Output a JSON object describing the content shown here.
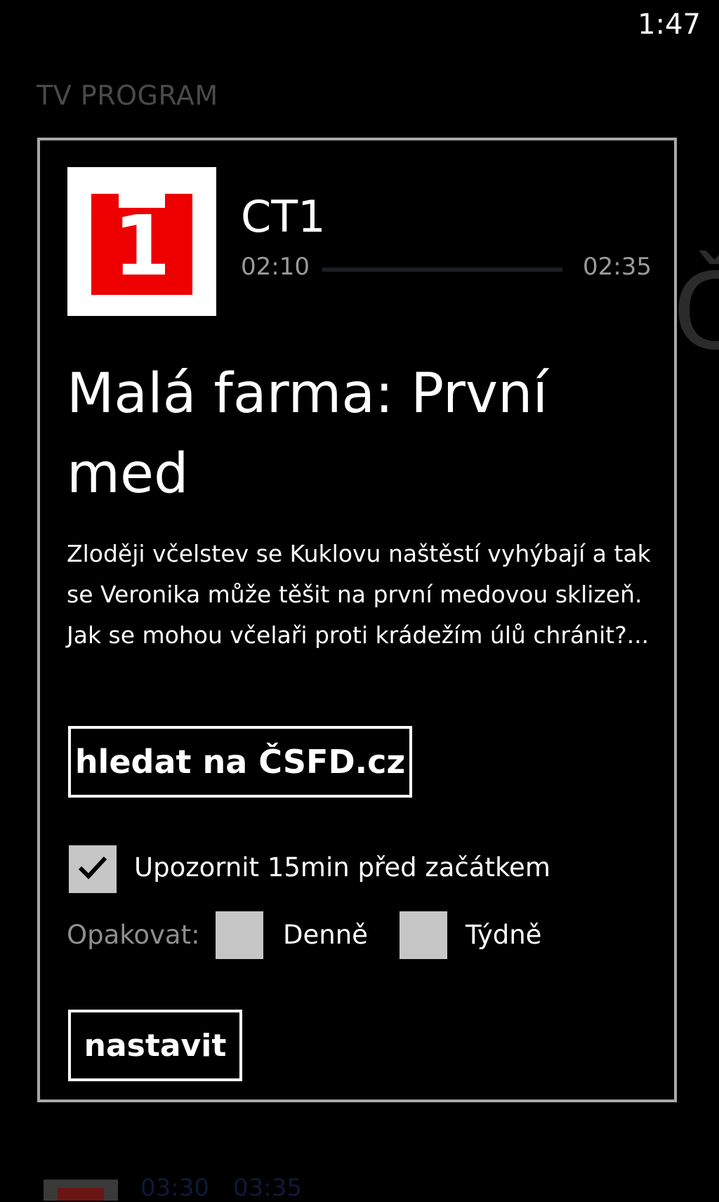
{
  "status_bar": {
    "time": "1:47"
  },
  "app": {
    "title": "TV PROGRAM"
  },
  "dialog": {
    "channel": {
      "name": "CT1",
      "logo_number": "1"
    },
    "schedule": {
      "start": "02:10",
      "end": "02:35",
      "progress": 0
    },
    "show": {
      "title": "Malá farma: První med",
      "description": "Zloději včelstev se Kuklovu naštěstí vyhýbají a tak se Veronika může těšit na první medovou sklizeň. Jak se mohou včelaři proti krádežím úlů chránit?..."
    },
    "search_button": {
      "label": "hledat na ČSFD.cz"
    },
    "notify": {
      "label": "Upozornit 15min před začátkem",
      "checked": true
    },
    "repeat": {
      "label": "Opakovat:",
      "daily": {
        "label": "Denně",
        "checked": false
      },
      "weekly": {
        "label": "Týdně",
        "checked": false
      }
    },
    "set_button": {
      "label": "nastavit"
    }
  },
  "background_list": {
    "next_item": {
      "start": "03:30",
      "end": "03:35"
    }
  },
  "colors": {
    "background": "#000000",
    "channel_red": "#ee0000",
    "checkbox_fill": "#c6c6c6",
    "dialog_border": "#a8a8a8"
  }
}
